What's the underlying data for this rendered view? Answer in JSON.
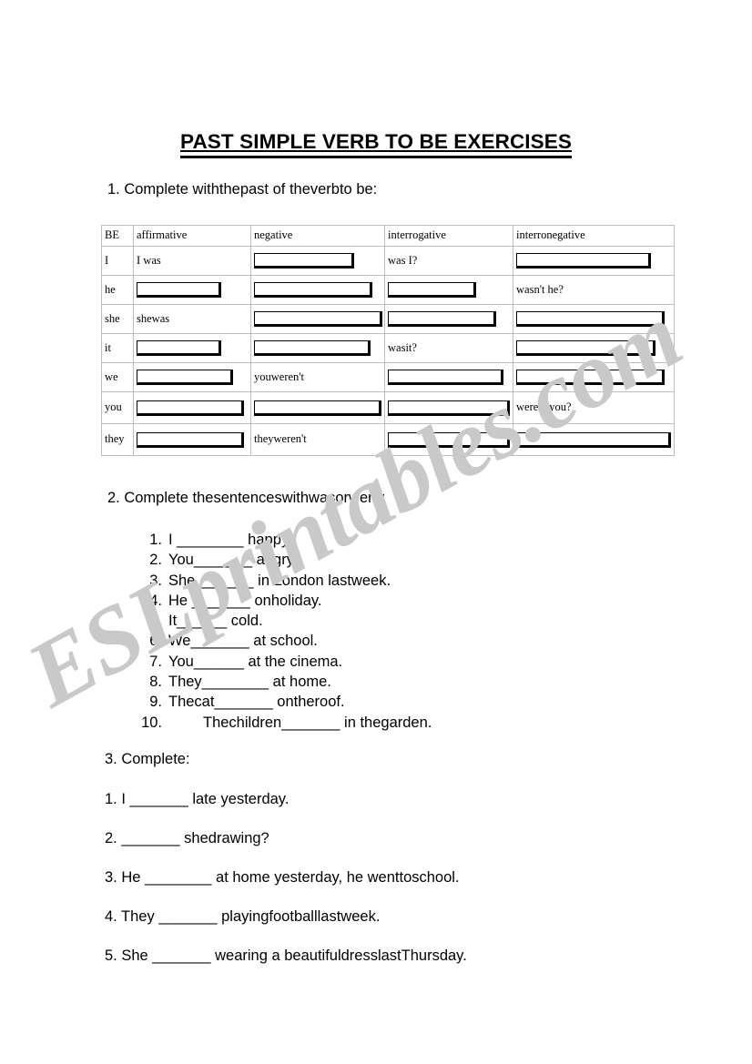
{
  "document": {
    "title": "PAST SIMPLE VERB TO BE EXERCISES",
    "watermark": "ESLprintables.com"
  },
  "sections": {
    "one": {
      "instruction": "1. Complete withthepast of theverbto be:"
    },
    "two": {
      "instruction": "2. Complete thesentenceswithwasorwere:"
    },
    "three": {
      "instruction": "3. Complete:"
    }
  },
  "table": {
    "headers": [
      "BE",
      "affirmative",
      "negative",
      "interrogative",
      "interronegative"
    ],
    "rows": [
      {
        "pronoun": "I",
        "affirmative": "I was",
        "negative": "",
        "interrogative": "was I?",
        "interronegative": ""
      },
      {
        "pronoun": "he",
        "affirmative": "",
        "negative": "",
        "interrogative": "",
        "interronegative": "wasn't he?"
      },
      {
        "pronoun": "she",
        "affirmative": "shewas",
        "negative": "",
        "interrogative": "",
        "interronegative": ""
      },
      {
        "pronoun": "it",
        "affirmative": "",
        "negative": "",
        "interrogative": "wasit?",
        "interronegative": ""
      },
      {
        "pronoun": "we",
        "affirmative": "",
        "negative": "youweren't",
        "interrogative": "",
        "interronegative": ""
      },
      {
        "pronoun": "you",
        "affirmative": "",
        "negative": "",
        "interrogative": "",
        "interronegative": "weren'tyou?"
      },
      {
        "pronoun": "they",
        "affirmative": "",
        "negative": "theyweren't",
        "interrogative": "",
        "interronegative": ""
      }
    ]
  },
  "exercise2": {
    "items": [
      {
        "number": "1.",
        "text": "I ________ happy."
      },
      {
        "number": "2.",
        "text": "You_______ angry."
      },
      {
        "number": "3.",
        "text": "She_______  in London lastweek."
      },
      {
        "number": "4.",
        "text": "He _______  onholiday."
      },
      {
        "number": "5.",
        "text": "It______  cold."
      },
      {
        "number": "6.",
        "text": "We_______ at school."
      },
      {
        "number": "7.",
        "text": "You______ at the cinema."
      },
      {
        "number": "8.",
        "text": "They________ at home."
      },
      {
        "number": "9.",
        "text": "Thecat_______  ontheroof."
      },
      {
        "number": "10.",
        "text": "Thechildren_______ in thegarden."
      }
    ]
  },
  "exercise3": {
    "items": [
      {
        "text": "1. I _______ late yesterday."
      },
      {
        "text": "2.  _______ shedrawing?"
      },
      {
        "text": "3. He ________ at home yesterday, he wenttoschool."
      },
      {
        "text": "4. They _______ playingfootballlastweek."
      },
      {
        "text": "5. She  _______ wearing a beautifuldresslastThursday."
      }
    ]
  }
}
